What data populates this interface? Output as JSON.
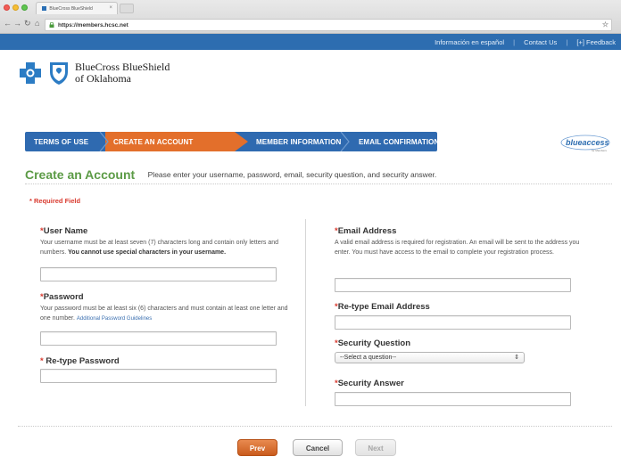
{
  "browser": {
    "tab_title": "BlueCross BlueShield",
    "tab_close": "×",
    "url": "https://members.hcsc.net"
  },
  "topbar": {
    "links": [
      "Información en español",
      "Contact Us",
      "[+] Feedback"
    ]
  },
  "brand": {
    "line1": "BlueCross BlueShield",
    "line2": "of Oklahoma"
  },
  "steps": [
    "TERMS OF USE",
    "CREATE AN ACCOUNT",
    "MEMBER INFORMATION",
    "EMAIL CONFIRMATION"
  ],
  "active_step": "CREATE AN ACCOUNT",
  "blue_access": {
    "name": "blueaccess",
    "tagline": "for Members"
  },
  "page": {
    "title": "Create an Account",
    "subtitle": "Please enter your username, password, email, security question, and security answer.",
    "required_note": "* Required Field"
  },
  "form": {
    "username": {
      "label": "User Name",
      "help_prefix": "Your username must be at least seven (7) characters long and contain only letters and numbers.",
      "help_bold": "You cannot use special characters in your username.",
      "value": ""
    },
    "password": {
      "label": "Password",
      "help": "Your password must be at least six (6) characters and must contain at least one letter and one number.",
      "link": "Additional Password Guidelines",
      "value": ""
    },
    "retype_password": {
      "label": "Re-type Password",
      "value": ""
    },
    "email": {
      "label": "Email Address",
      "help": "A valid email address is required for registration. An email will be sent to the address you enter. You must have access to the email to complete your registration process.",
      "value": ""
    },
    "retype_email": {
      "label": "Re-type Email Address",
      "value": ""
    },
    "security_question": {
      "label": "Security Question",
      "selected": "--Select a question--"
    },
    "security_answer": {
      "label": "Security Answer",
      "value": ""
    }
  },
  "buttons": {
    "prev": "Prev",
    "cancel": "Cancel",
    "next": "Next"
  },
  "colors": {
    "brand_blue": "#2d6db0",
    "active_orange": "#e36f2b",
    "heading_green": "#5c9b46",
    "required_red": "#d93a2f"
  }
}
